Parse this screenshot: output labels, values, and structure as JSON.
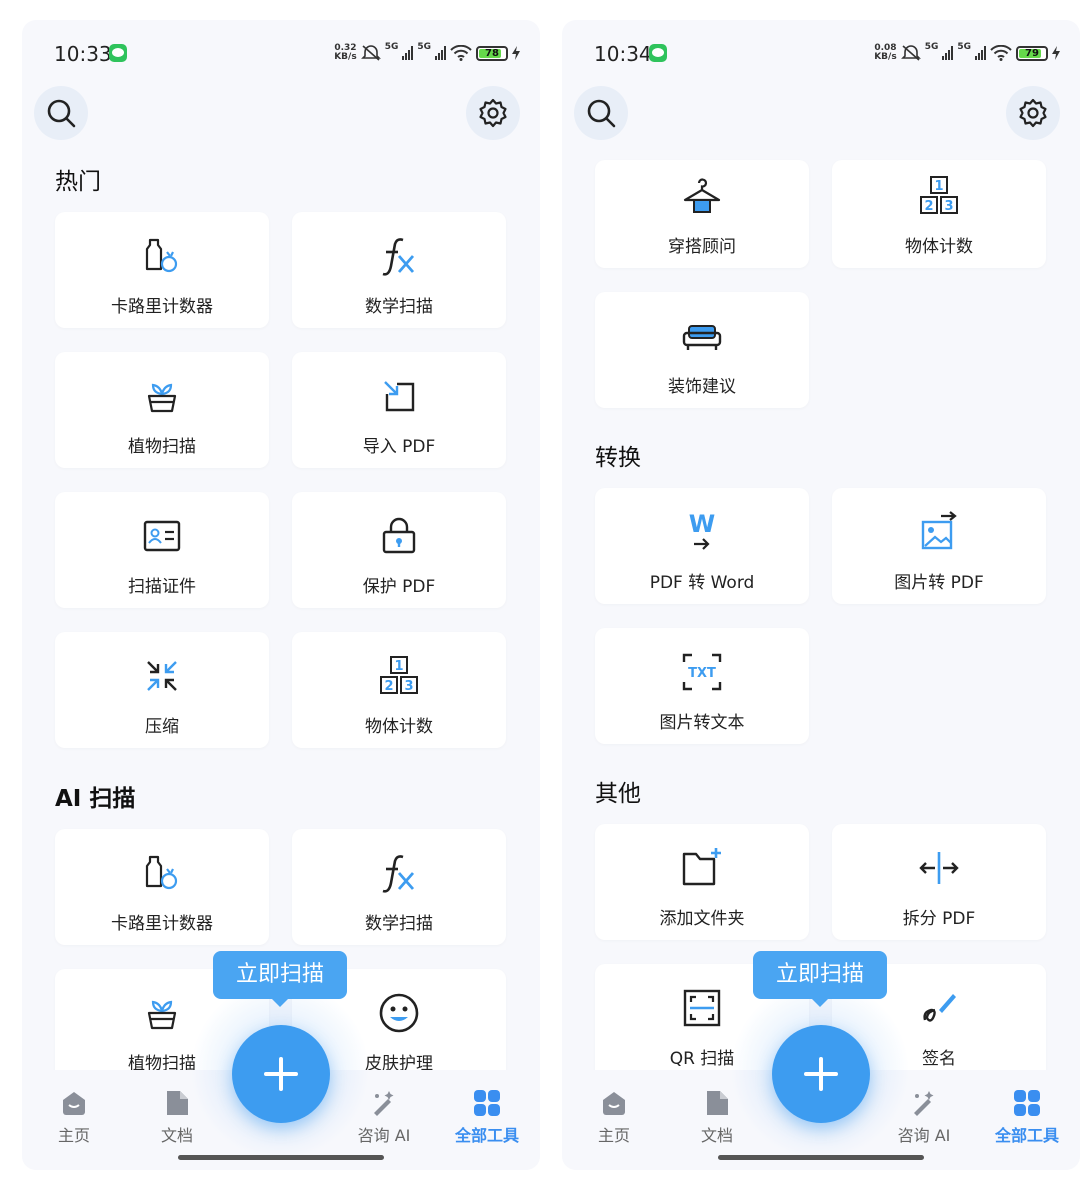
{
  "left_screen": {
    "status": {
      "time": "10:33",
      "net_speed": "0.32",
      "net_unit": "KB/s",
      "sig1": "5G",
      "sig2": "5G",
      "battery": "78"
    },
    "sections": [
      {
        "title": "热门",
        "items": [
          {
            "label": "卡路里计数器",
            "icon": "calorie-counter-icon"
          },
          {
            "label": "数学扫描",
            "icon": "fx-math-icon"
          },
          {
            "label": "植物扫描",
            "icon": "plant-icon"
          },
          {
            "label": "导入 PDF",
            "icon": "import-pdf-icon"
          },
          {
            "label": "扫描证件",
            "icon": "id-card-icon"
          },
          {
            "label": "保护 PDF",
            "icon": "lock-icon"
          },
          {
            "label": "压缩",
            "icon": "compress-icon"
          },
          {
            "label": "物体计数",
            "icon": "object-count-icon"
          }
        ]
      },
      {
        "title": "AI 扫描",
        "items": [
          {
            "label": "卡路里计数器",
            "icon": "calorie-counter-icon"
          },
          {
            "label": "数学扫描",
            "icon": "fx-math-icon"
          },
          {
            "label": "植物扫描",
            "icon": "plant-icon"
          },
          {
            "label": "皮肤护理",
            "icon": "smiley-face-icon"
          }
        ]
      }
    ]
  },
  "right_screen": {
    "status": {
      "time": "10:34",
      "net_speed": "0.08",
      "net_unit": "KB/s",
      "sig1": "5G",
      "sig2": "5G",
      "battery": "79"
    },
    "top_items": [
      {
        "label": "穿搭顾问",
        "icon": "hanger-icon"
      },
      {
        "label": "物体计数",
        "icon": "object-count-icon"
      },
      {
        "label": "装饰建议",
        "icon": "sofa-icon"
      }
    ],
    "sections": [
      {
        "title": "转换",
        "items": [
          {
            "label": "PDF 转 Word",
            "icon": "pdf-to-word-icon"
          },
          {
            "label": "图片转 PDF",
            "icon": "image-to-pdf-icon"
          },
          {
            "label": "图片转文本",
            "icon": "image-to-text-icon"
          }
        ]
      },
      {
        "title": "其他",
        "items": [
          {
            "label": "添加文件夹",
            "icon": "add-folder-icon"
          },
          {
            "label": "拆分 PDF",
            "icon": "split-pdf-icon"
          },
          {
            "label": "QR 扫描",
            "icon": "qr-scan-icon"
          },
          {
            "label": "签名",
            "icon": "signature-icon"
          }
        ]
      }
    ]
  },
  "fab": {
    "tooltip": "立即扫描",
    "icon": "plus-icon"
  },
  "nav": [
    {
      "label": "主页",
      "icon": "home-icon",
      "active": false
    },
    {
      "label": "文档",
      "icon": "document-icon",
      "active": false
    },
    {
      "label": "咨询 AI",
      "icon": "magic-wand-icon",
      "active": false
    },
    {
      "label": "全部工具",
      "icon": "grid-tools-icon",
      "active": true
    }
  ],
  "colors": {
    "accent": "#3d9cf0",
    "background": "#f7f8fc",
    "card": "#ffffff",
    "active_nav": "#3a8ef0"
  }
}
